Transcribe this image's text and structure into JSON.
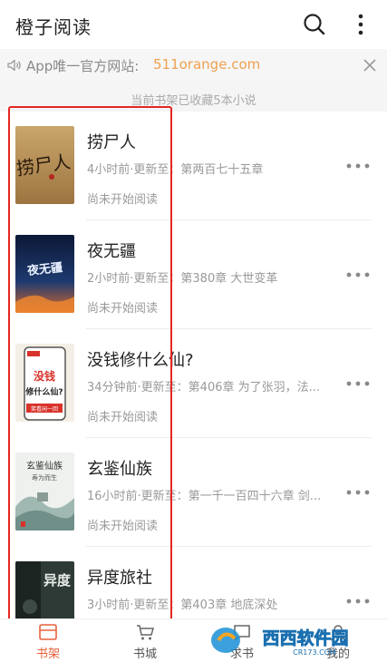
{
  "header": {
    "title": "橙子阅读",
    "search_icon": "search-icon",
    "more_icon": "more-vert-icon"
  },
  "notice": {
    "prefix": "App唯一官方网站:",
    "link": "511orange.com",
    "speaker_icon": "speaker-icon",
    "close_icon": "close-icon"
  },
  "shelf": {
    "count_text": "当前书架已收藏5本小说",
    "books": [
      {
        "title": "捞尸人",
        "update": "4小时前·更新至：第两百七十五章",
        "progress": "尚未开始阅读"
      },
      {
        "title": "夜无疆",
        "update": "2小时前·更新至：第380章 大世变革",
        "progress": "尚未开始阅读"
      },
      {
        "title": "没钱修什么仙?",
        "update": "34分钟前·更新至：第406章 为了张羽，法...",
        "progress": "尚未开始阅读"
      },
      {
        "title": "玄鉴仙族",
        "update": "16小时前·更新至：第一千一百四十六章 剑...",
        "progress": "尚未开始阅读"
      },
      {
        "title": "异度旅社",
        "update": "3小时前·更新至：第403章 地底深处",
        "progress": ""
      }
    ]
  },
  "covers": {
    "c1": "捞尸人",
    "c2": "夜无疆",
    "c3a": "没钱",
    "c3b": "修什么仙?",
    "c3c": "笑看闲一回",
    "c4a": "玄鉴仙族",
    "c4b": "寿为而生",
    "c5": "异度"
  },
  "tabs": [
    {
      "label": "书架",
      "icon": "bookshelf-icon",
      "active": true
    },
    {
      "label": "书城",
      "icon": "store-cart-icon",
      "active": false
    },
    {
      "label": "求书",
      "icon": "request-book-icon",
      "active": false
    },
    {
      "label": "我的",
      "icon": "profile-icon",
      "active": false
    }
  ],
  "watermark": {
    "name": "西西软件园",
    "url": "CR173.COM"
  },
  "colors": {
    "accent": "#e8603c",
    "highlight": "#e52620",
    "link": "#f0a050"
  }
}
